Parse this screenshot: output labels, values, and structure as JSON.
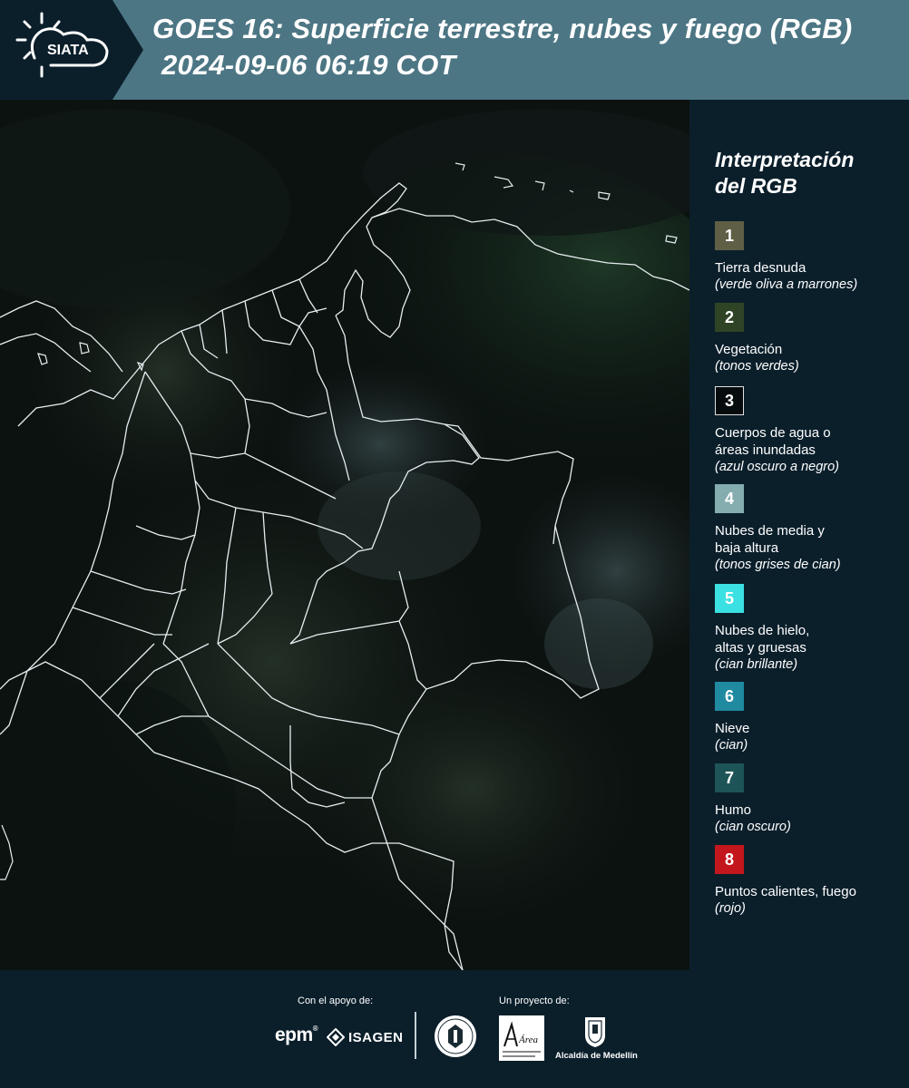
{
  "header": {
    "logo_text": "SIATA",
    "title_line1": "GOES 16: Superficie terrestre, nubes y fuego (RGB)",
    "title_line2": "2024-09-06 06:19 COT",
    "background": "#4d7684",
    "logo_background": "#0b1f2b"
  },
  "legend": {
    "title_line1": "Interpretación",
    "title_line2": "del RGB",
    "items": [
      {
        "number": "1",
        "label_line1": "Tierra desnuda",
        "label_line2": "",
        "sub": "(verde oliva a marrones)",
        "color": "#5e5f44"
      },
      {
        "number": "2",
        "label_line1": "Vegetación",
        "label_line2": "",
        "sub": "(tonos verdes)",
        "color": "#2f4425"
      },
      {
        "number": "3",
        "label_line1": "Cuerpos de agua o",
        "label_line2": "áreas inundadas",
        "sub": "(azul oscuro a negro)",
        "color": "#060b0d"
      },
      {
        "number": "4",
        "label_line1": "Nubes de media y",
        "label_line2": "baja altura",
        "sub": "(tonos grises de cian)",
        "color": "#85acae"
      },
      {
        "number": "5",
        "label_line1": "Nubes de hielo,",
        "label_line2": "altas y gruesas",
        "sub": "(cian brillante)",
        "color": "#3be0e2"
      },
      {
        "number": "6",
        "label_line1": "Nieve",
        "label_line2": "",
        "sub": "(cian)",
        "color": "#1f8aa0"
      },
      {
        "number": "7",
        "label_line1": "Humo",
        "label_line2": "",
        "sub": "(cian oscuro)",
        "color": "#1d5457"
      },
      {
        "number": "8",
        "label_line1": "Puntos calientes, fuego",
        "label_line2": "",
        "sub": "(rojo)",
        "color": "#c4161d"
      }
    ]
  },
  "footer": {
    "support_label": "Con el apoyo de:",
    "project_label": "Un proyecto de:",
    "epm_text": "epm",
    "isagen_text": "ISAGEN",
    "area_text": "Área",
    "alcaldia_text": "Alcaldía de Medellín"
  },
  "icons": {
    "logo": "sun-cloud-icon",
    "isagen": "isagen-mark-icon",
    "seal": "medellin-seal-icon",
    "alcaldia": "coat-of-arms-icon"
  }
}
